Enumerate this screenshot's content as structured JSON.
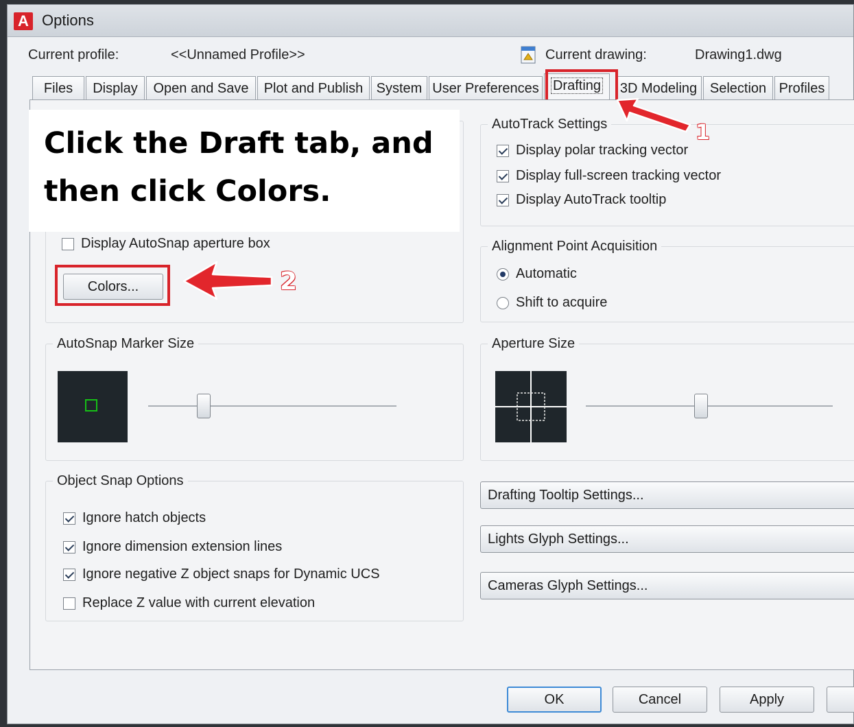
{
  "window": {
    "title": "Options",
    "logo": "A"
  },
  "profile": {
    "current_profile_label": "Current profile:",
    "current_profile_value": "<<Unnamed Profile>>",
    "current_drawing_label": "Current drawing:",
    "current_drawing_value": "Drawing1.dwg"
  },
  "tabs": [
    {
      "label": "Files"
    },
    {
      "label": "Display"
    },
    {
      "label": "Open and Save"
    },
    {
      "label": "Plot and Publish"
    },
    {
      "label": "System"
    },
    {
      "label": "User Preferences"
    },
    {
      "label": "Drafting",
      "active": true
    },
    {
      "label": "3D Modeling"
    },
    {
      "label": "Selection"
    },
    {
      "label": "Profiles"
    }
  ],
  "instruction": {
    "line1": "Click the Draft tab, and",
    "line2": "then click Colors."
  },
  "steps": {
    "one": "1",
    "two": "2"
  },
  "autosnap": {
    "aperture_box_label": "Display AutoSnap aperture box",
    "aperture_box_checked": false,
    "colors_button": "Colors..."
  },
  "autotrack": {
    "legend": "AutoTrack Settings",
    "items": [
      {
        "label": "Display polar tracking vector",
        "checked": true
      },
      {
        "label": "Display full-screen tracking vector",
        "checked": true
      },
      {
        "label": "Display AutoTrack tooltip",
        "checked": true
      }
    ]
  },
  "alignment": {
    "legend": "Alignment Point Acquisition",
    "options": [
      {
        "label": "Automatic",
        "selected": true
      },
      {
        "label": "Shift to acquire",
        "selected": false
      }
    ]
  },
  "marker_size": {
    "legend": "AutoSnap Marker Size",
    "level": 0.23
  },
  "aperture_size": {
    "legend": "Aperture Size",
    "level": 0.47
  },
  "object_snap": {
    "legend": "Object Snap Options",
    "items": [
      {
        "label": "Ignore hatch objects",
        "checked": true
      },
      {
        "label": "Ignore dimension extension lines",
        "checked": true
      },
      {
        "label": "Ignore negative Z object snaps for Dynamic UCS",
        "checked": true
      },
      {
        "label": "Replace Z value with current elevation",
        "checked": false
      }
    ]
  },
  "side_buttons": {
    "tooltip": "Drafting Tooltip Settings...",
    "lights": "Lights Glyph Settings...",
    "cameras": "Cameras Glyph Settings..."
  },
  "footer": {
    "ok": "OK",
    "cancel": "Cancel",
    "apply": "Apply"
  },
  "colors": {
    "highlight": "#d8232a",
    "preview_bg": "#1f262b",
    "marker": "#16c016"
  }
}
